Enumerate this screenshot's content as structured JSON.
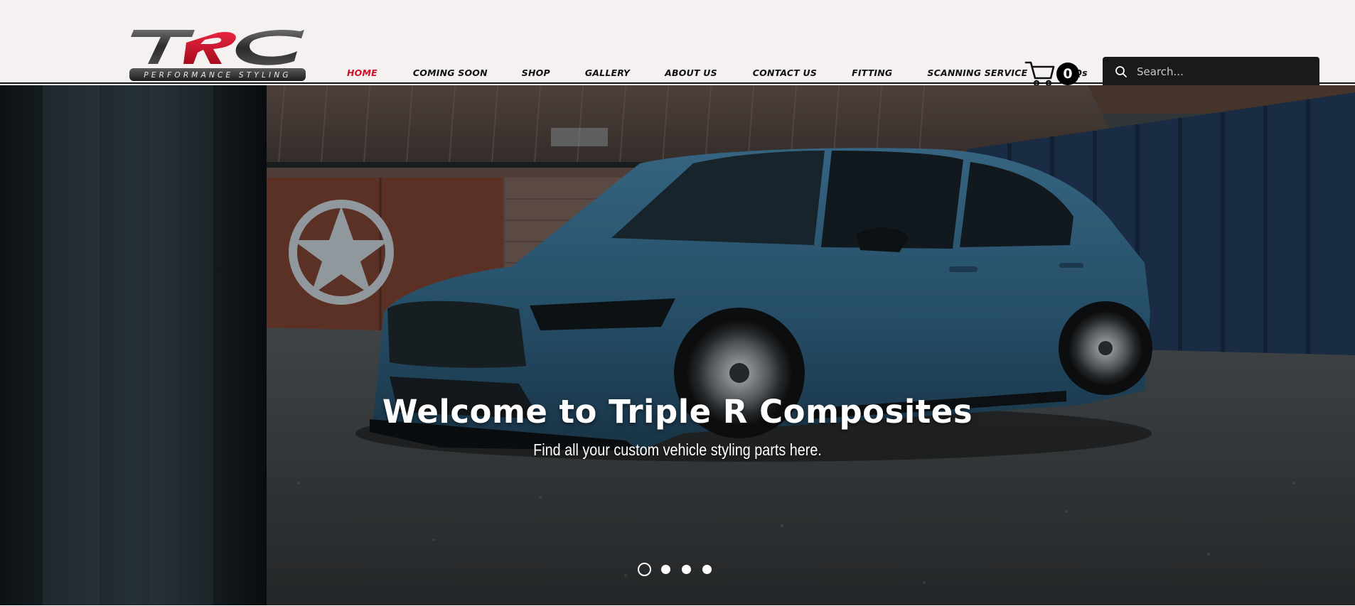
{
  "brand": {
    "logo_letters": "TRC",
    "logo_tagline": "PERFORMANCE STYLING"
  },
  "nav": {
    "items": [
      {
        "label": "HOME",
        "active": true
      },
      {
        "label": "COMING SOON",
        "active": false
      },
      {
        "label": "SHOP",
        "active": false
      },
      {
        "label": "GALLERY",
        "active": false
      },
      {
        "label": "ABOUT US",
        "active": false
      },
      {
        "label": "CONTACT US",
        "active": false
      },
      {
        "label": "FITTING",
        "active": false
      },
      {
        "label": "SCANNING SERVICE",
        "active": false
      },
      {
        "label": "FAQs",
        "active": false
      }
    ]
  },
  "cart": {
    "icon": "cart-icon",
    "count": "0"
  },
  "search": {
    "icon": "search-icon",
    "placeholder": "Search..."
  },
  "hero": {
    "title": "Welcome to Triple R Composites",
    "subtitle": "Find all your custom vehicle styling parts here.",
    "slide_count": 4,
    "active_slide": 1
  },
  "colors": {
    "header_bg": "#f4f1f0",
    "accent_red": "#d3102a",
    "nav_text": "#111111",
    "search_bg": "#1a1a1a",
    "car_blue": "#2f5d78"
  }
}
